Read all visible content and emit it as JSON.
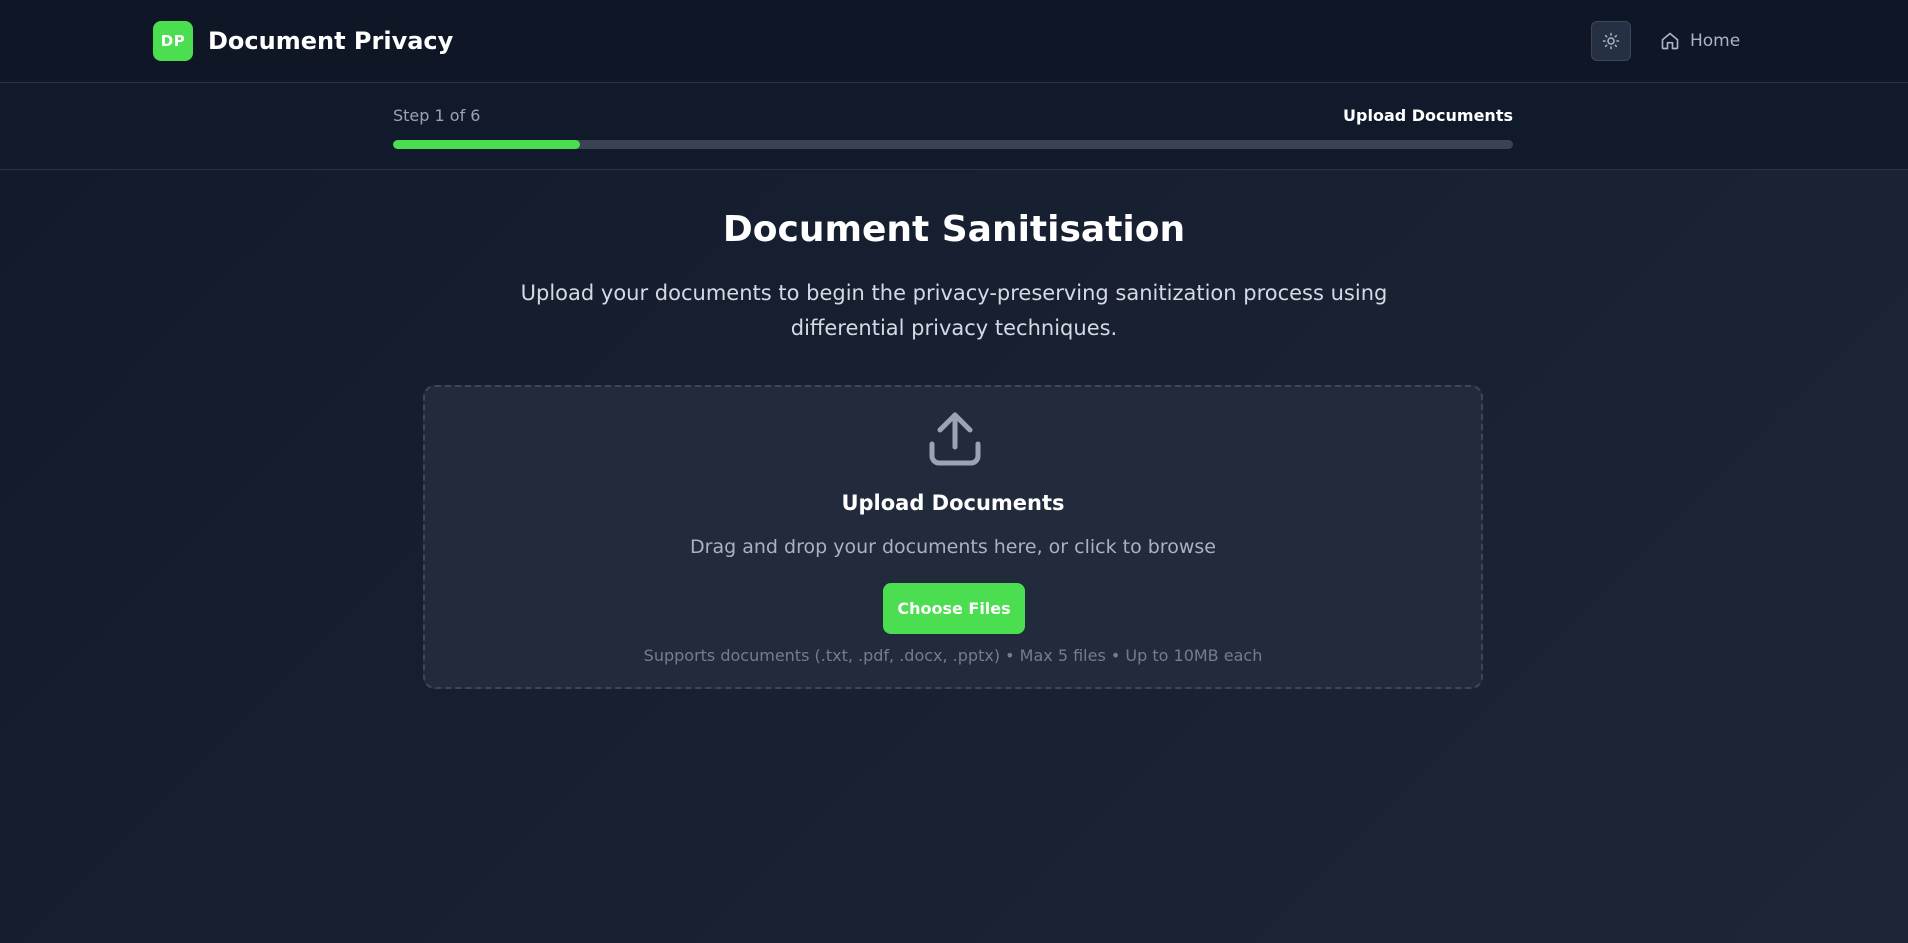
{
  "header": {
    "logo_text": "DP",
    "brand_title": "Document Privacy",
    "theme_toggle_icon": "sun-icon",
    "home_icon": "home-icon",
    "home_label": "Home"
  },
  "progress": {
    "step_label": "Step 1 of 6",
    "step_name": "Upload Documents",
    "percent": 16.67
  },
  "main": {
    "title": "Document Sanitisation",
    "subtitle": "Upload your documents to begin the privacy-preserving sanitization process using differential privacy techniques."
  },
  "dropzone": {
    "icon": "upload-icon",
    "title": "Upload Documents",
    "description": "Drag and drop your documents here, or click to browse",
    "button_label": "Choose Files",
    "note": "Supports documents (.txt, .pdf, .docx, .pptx) • Max 5 files • Up to 10MB each"
  },
  "colors": {
    "accent": "#4ade50",
    "background": "#172031",
    "header_background": "#0f1727"
  }
}
